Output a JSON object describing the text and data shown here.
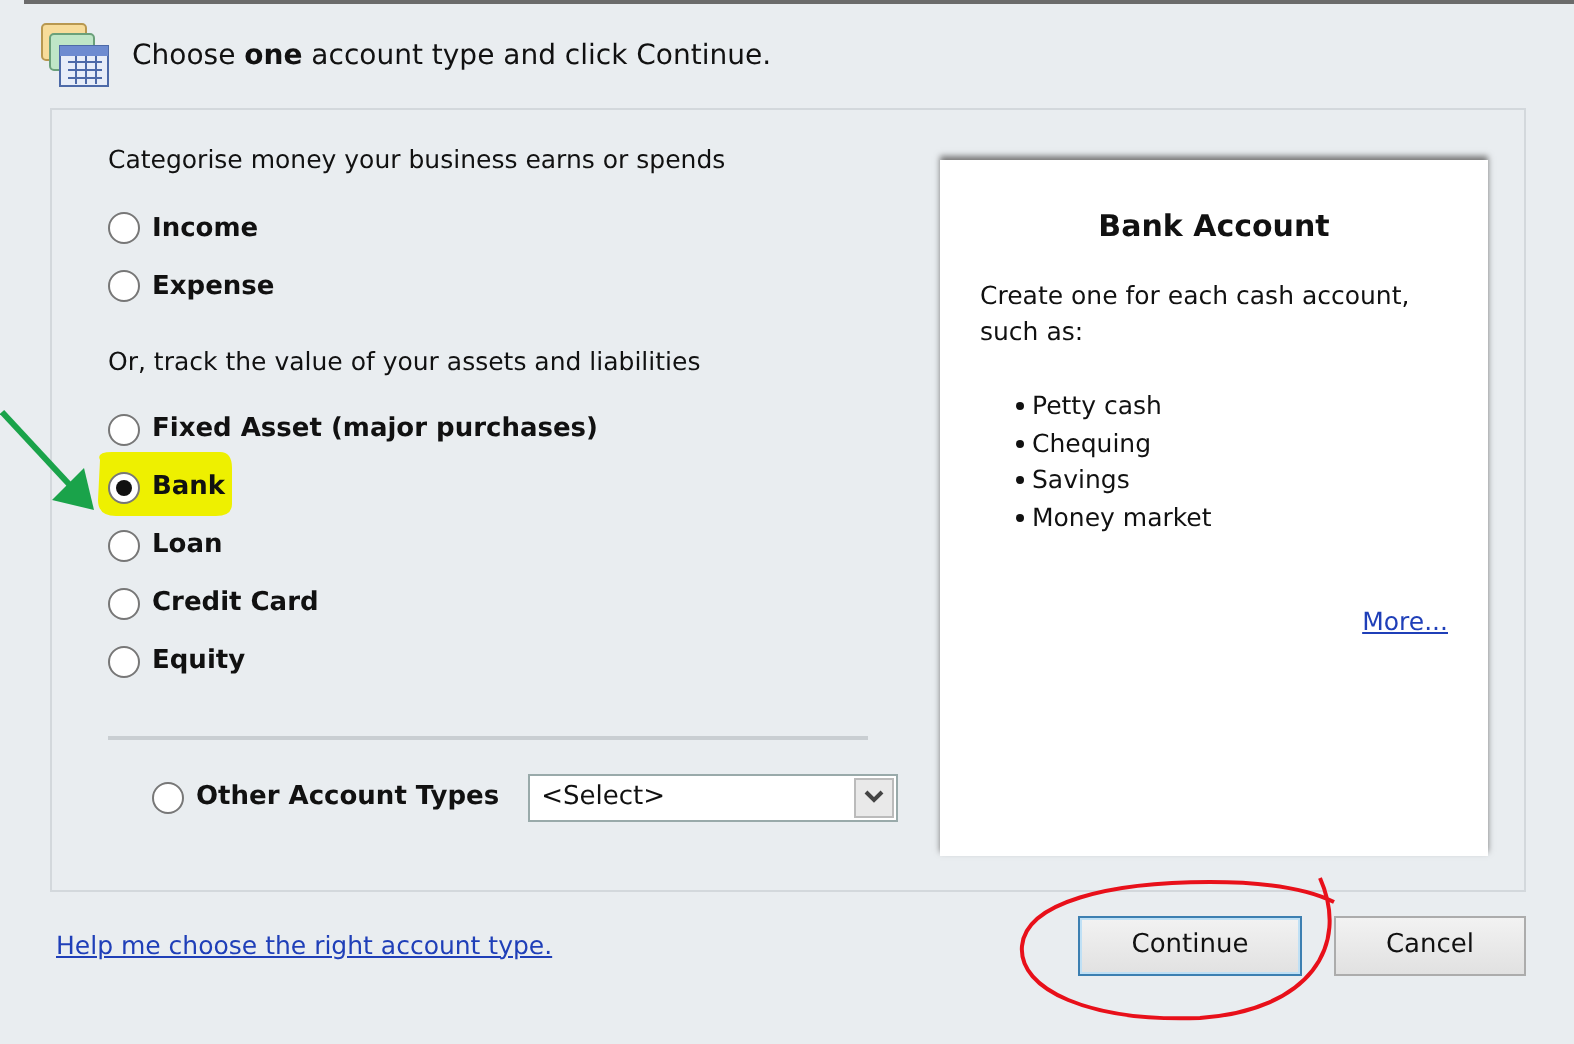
{
  "header": {
    "title": "Choose **one** account type and click Continue."
  },
  "sections": [
    {
      "heading": "Categorise money your business earns or spends",
      "options": [
        {
          "label": "Income",
          "selected": false
        },
        {
          "label": "Expense",
          "selected": false
        }
      ]
    },
    {
      "heading": "Or, track the value of your assets and liabilities",
      "options": [
        {
          "label": "Fixed Asset (major purchases)",
          "selected": false
        },
        {
          "label": "Bank",
          "selected": true
        },
        {
          "label": "Loan",
          "selected": false
        },
        {
          "label": "Credit Card",
          "selected": false
        },
        {
          "label": "Equity",
          "selected": false
        }
      ]
    }
  ],
  "other_types": {
    "label": "Other Account Types",
    "selected": false,
    "value": "<Select>"
  },
  "info_card": {
    "title": "Bank Account",
    "text": "Create one for each cash account, such as:",
    "bullets": [
      "Petty cash",
      "Chequing",
      "Savings",
      "Money market"
    ],
    "link": "More..."
  },
  "help_link": "Help me choose the right account type.",
  "buttons": [
    {
      "label": "Continue",
      "focused": true
    },
    {
      "label": "Cancel",
      "focused": false
    }
  ],
  "annotations": [
    {
      "kind": "arrow",
      "color": "#1aa34a"
    },
    {
      "kind": "highlight",
      "color": "#eef000"
    },
    {
      "kind": "ellipse",
      "color": "#e8101a"
    }
  ]
}
